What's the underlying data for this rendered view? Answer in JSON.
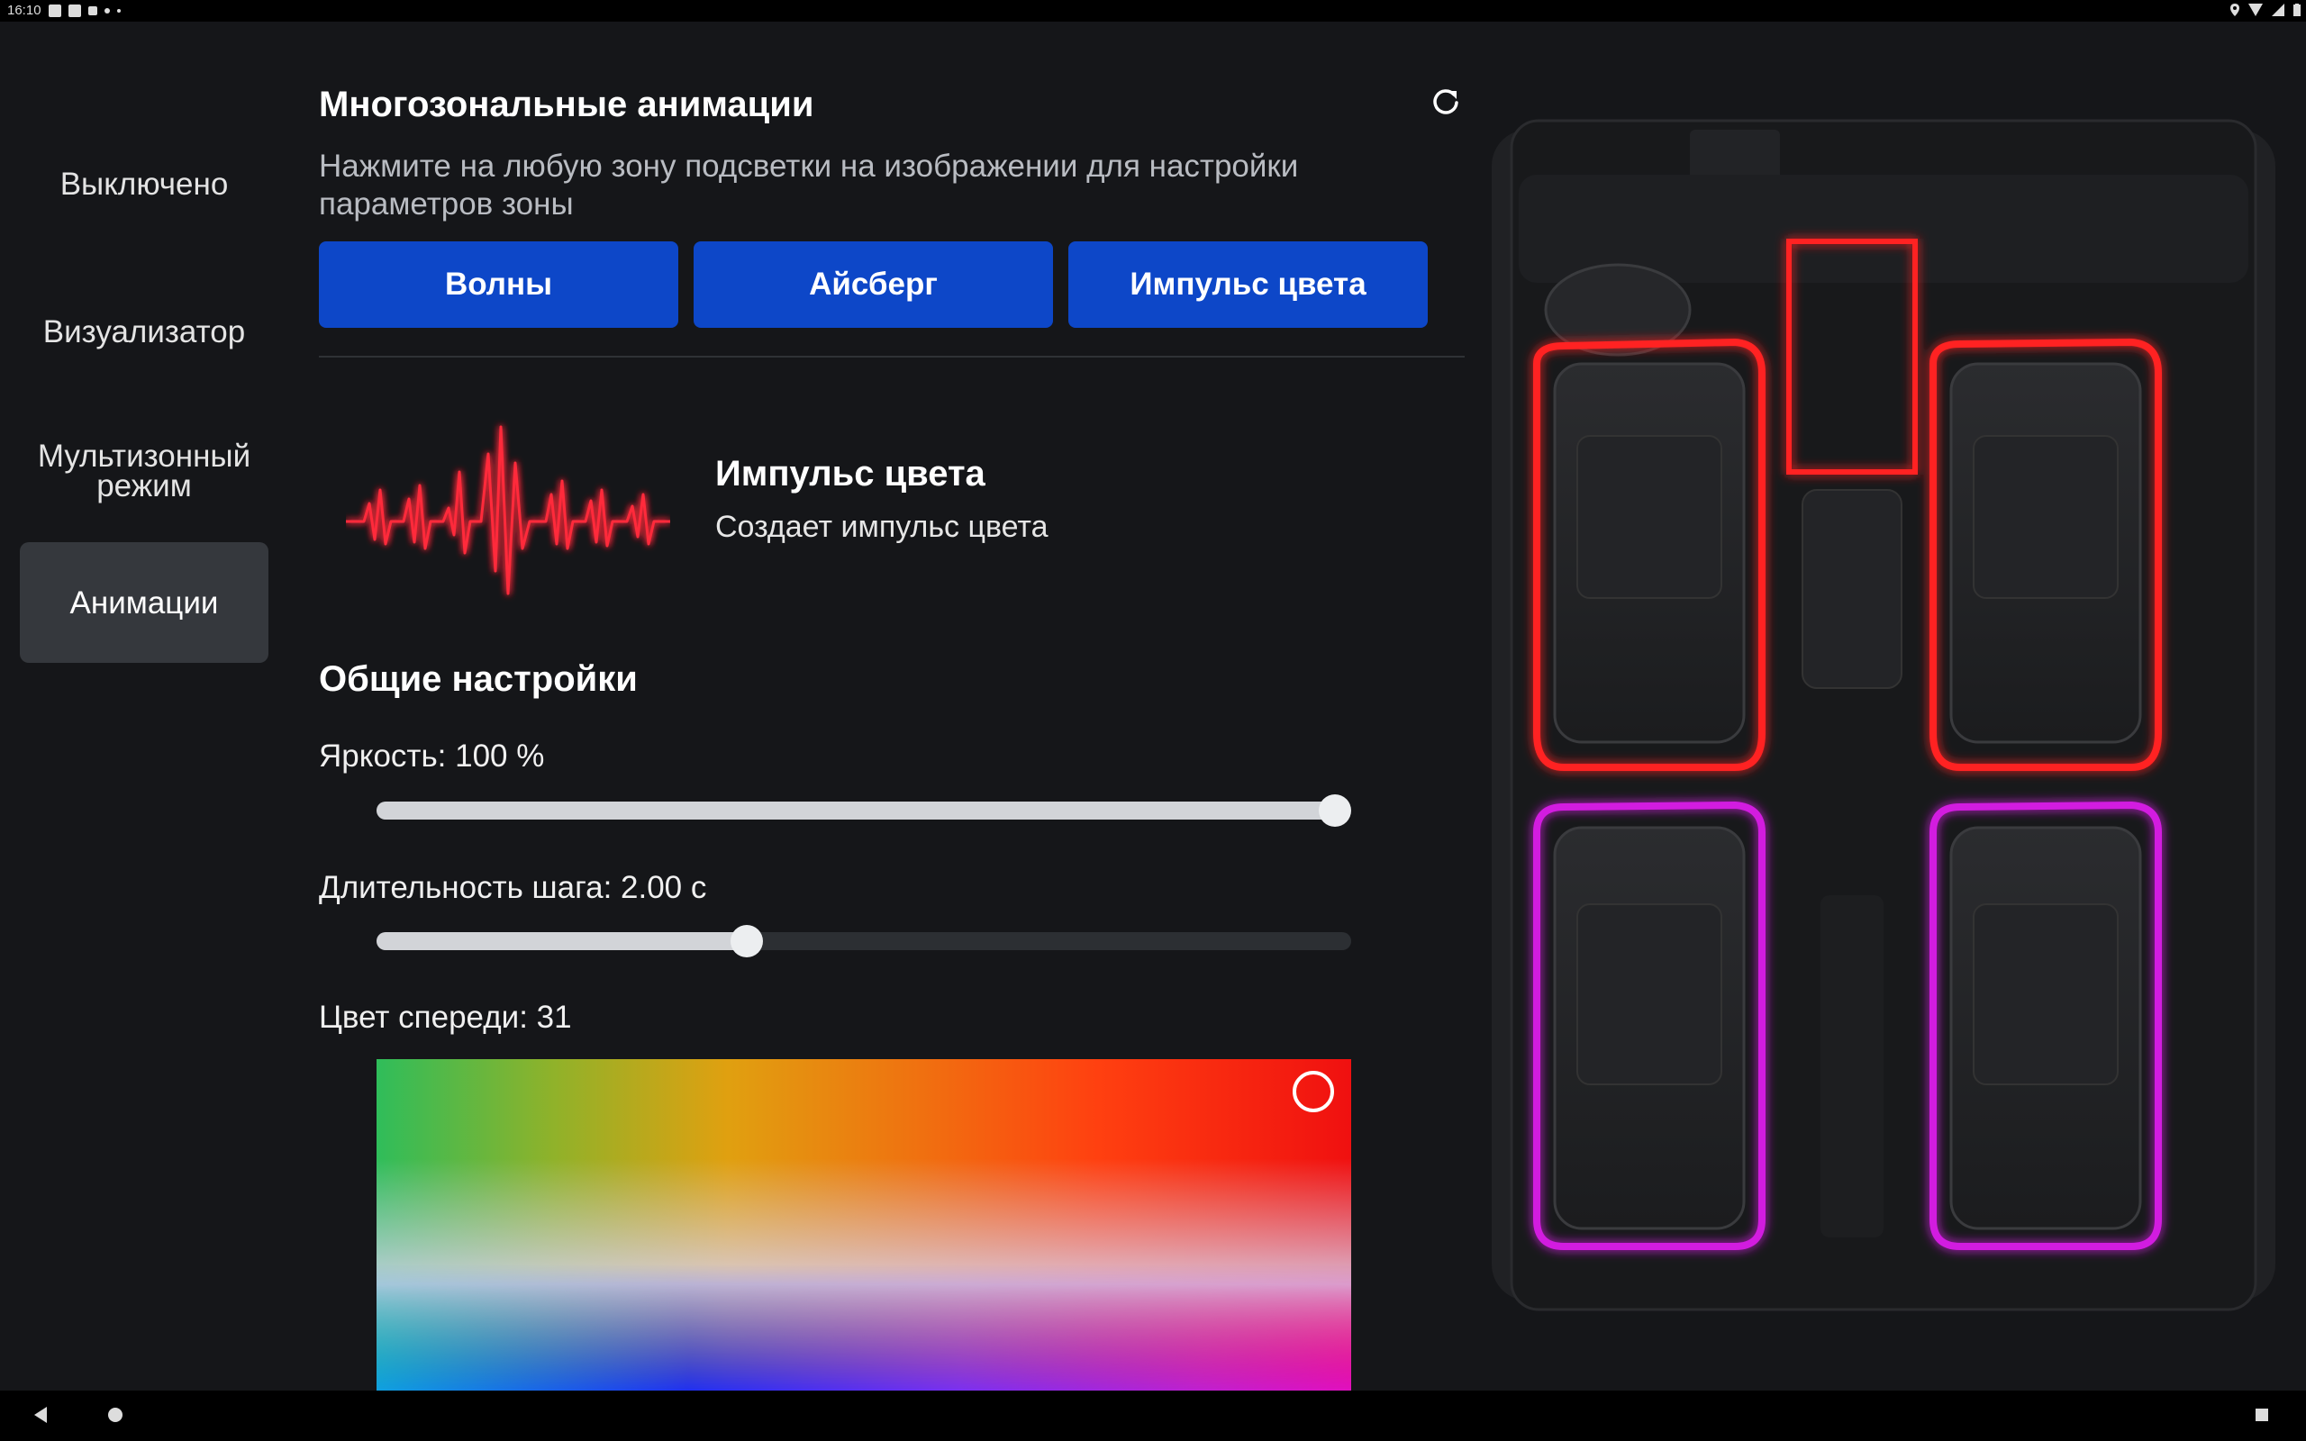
{
  "status_bar": {
    "time": "16:10"
  },
  "sidebar": {
    "items": [
      {
        "label": "Выключено"
      },
      {
        "label": "Визуализатор"
      },
      {
        "label": "Мультизонный режим"
      },
      {
        "label": "Анимации"
      }
    ],
    "active_index": 3
  },
  "main": {
    "title": "Многозональные анимации",
    "subtitle": "Нажмите на любую зону подсветки на изображении для настройки параметров зоны",
    "animation_buttons": [
      {
        "label": "Волны"
      },
      {
        "label": "Айсберг"
      },
      {
        "label": "Импульс цвета"
      }
    ],
    "selected_animation": {
      "name": "Импульс цвета",
      "description": "Создает импульс цвета"
    },
    "general_settings": {
      "title": "Общие настройки",
      "brightness_label": "Яркость: 100 %",
      "brightness_value": 1.0,
      "step_label": "Длительность шага: 2.00 с",
      "step_value": 0.38,
      "front_color_label": "Цвет спереди: 31"
    }
  },
  "colors": {
    "accent_button": "#0d47c8",
    "front_zone": "#ff2020",
    "rear_zone": "#d21ee0"
  },
  "icons": {
    "refresh": "refresh-icon",
    "back": "back-triangle-icon",
    "home": "home-circle-icon",
    "recents": "recents-square-icon"
  }
}
